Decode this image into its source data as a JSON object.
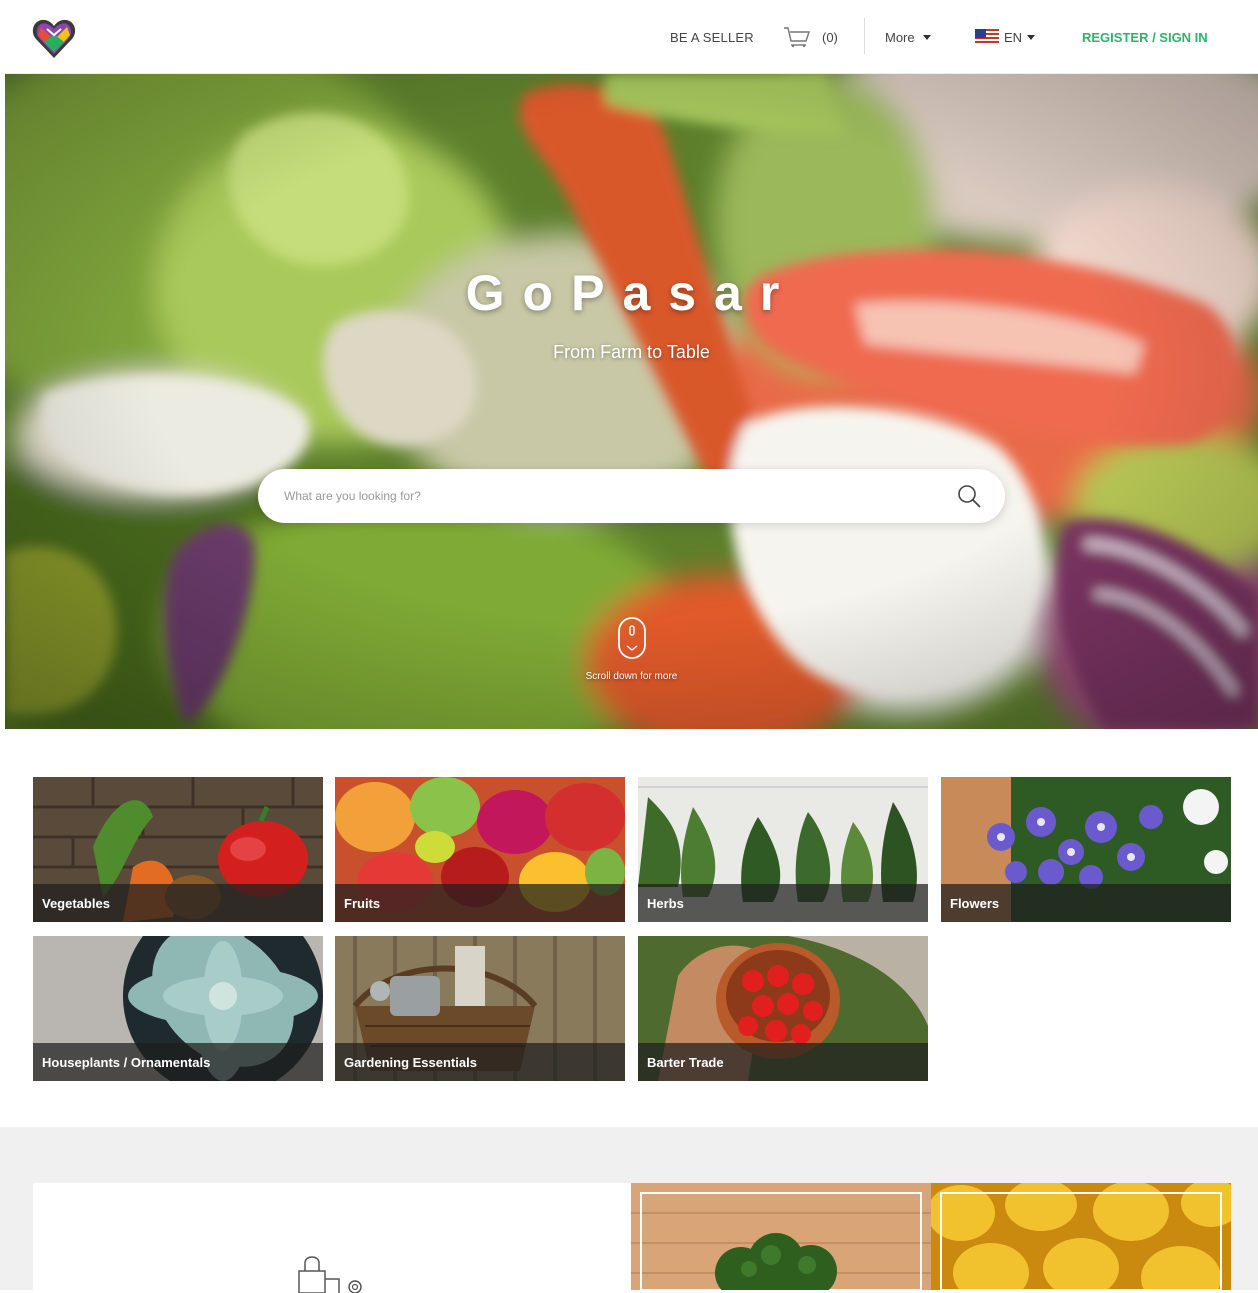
{
  "header": {
    "be_seller": "BE A SELLER",
    "cart_count": "(0)",
    "more": "More",
    "language": "EN",
    "register": "REGISTER / SIGN IN"
  },
  "hero": {
    "title": "GoPasar",
    "subtitle": "From Farm to Table",
    "search_placeholder": "What are you looking for?",
    "scroll_hint": "Scroll down for more"
  },
  "categories": [
    {
      "label": "Vegetables"
    },
    {
      "label": "Fruits"
    },
    {
      "label": "Herbs"
    },
    {
      "label": "Flowers"
    },
    {
      "label": "Houseplants / Ornamentals"
    },
    {
      "label": "Gardening Essentials"
    },
    {
      "label": "Barter Trade"
    }
  ],
  "colors": {
    "accent_green": "#2fb36b",
    "header_text": "#444444",
    "lower_background": "#f0f0f0"
  },
  "icons": {
    "logo": "heart-handshake-logo",
    "cart": "cart-icon",
    "flag": "us-flag-icon",
    "search": "search-icon",
    "scroll": "mouse-scroll-icon",
    "bag": "shopping-bag-icon"
  }
}
